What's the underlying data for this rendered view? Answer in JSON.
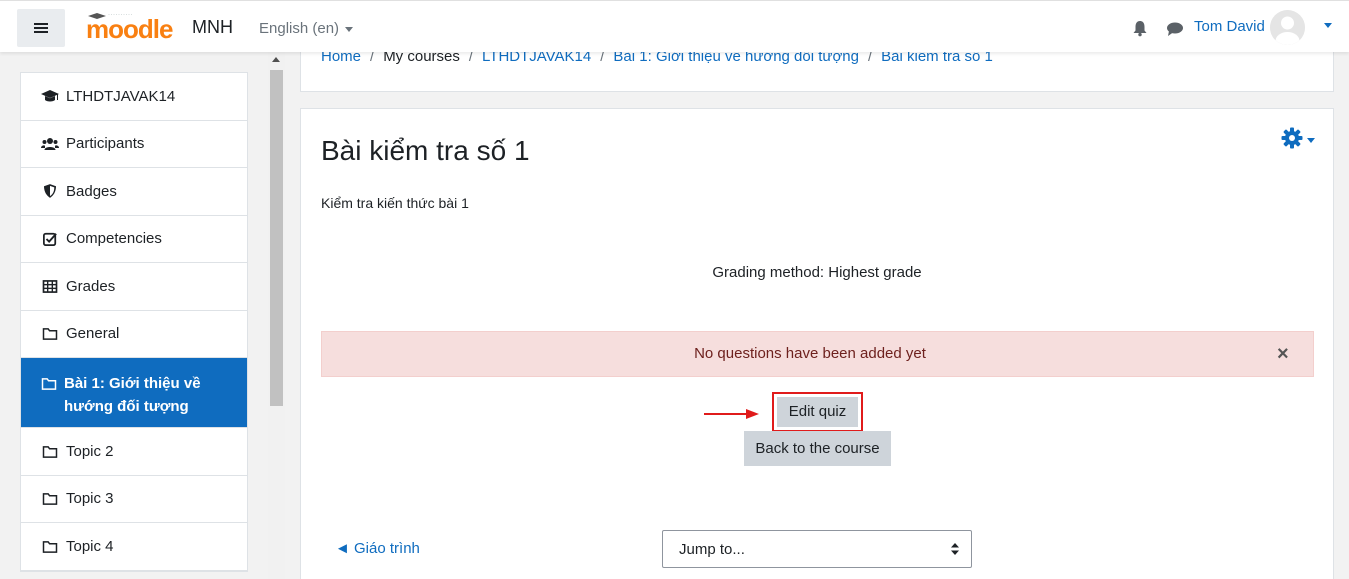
{
  "navbar": {
    "logo_text": "moodle",
    "site_name": "MNH",
    "language": "English (en)",
    "username": "Tom David"
  },
  "drawer": {
    "items": [
      {
        "label": "LTHDTJAVAK14",
        "icon": "graduation-cap-icon"
      },
      {
        "label": "Participants",
        "icon": "users-icon"
      },
      {
        "label": "Badges",
        "icon": "shield-icon"
      },
      {
        "label": "Competencies",
        "icon": "check-square-icon"
      },
      {
        "label": "Grades",
        "icon": "table-icon"
      },
      {
        "label": "General",
        "icon": "folder-icon"
      },
      {
        "label": "Bài 1: Giới thiệu về hướng đối tượng",
        "icon": "folder-icon",
        "active": true
      },
      {
        "label": "Topic 2",
        "icon": "folder-icon"
      },
      {
        "label": "Topic 3",
        "icon": "folder-icon"
      },
      {
        "label": "Topic 4",
        "icon": "folder-icon"
      }
    ]
  },
  "breadcrumb": {
    "home": "Home",
    "my_courses": "My courses",
    "course": "LTHDTJAVAK14",
    "section": "Bài 1: Giới thiệu về hướng đối tượng",
    "current": "Bài kiểm tra số 1",
    "separator": "/"
  },
  "main": {
    "title": "Bài kiểm tra số 1",
    "intro": "Kiểm tra kiến thức bài 1",
    "grading_method": "Grading method: Highest grade",
    "alert": "No questions have been added yet",
    "alert_close": "×",
    "edit_quiz": "Edit quiz",
    "back_to_course": "Back to the course",
    "prev_activity": "◄ Giáo trình",
    "jump_to": "Jump to..."
  },
  "colors": {
    "primary": "#0f6cbf",
    "alert_bg": "#f6dedd",
    "highlight_border": "#e01b1b",
    "moodle_orange": "#f98012"
  }
}
